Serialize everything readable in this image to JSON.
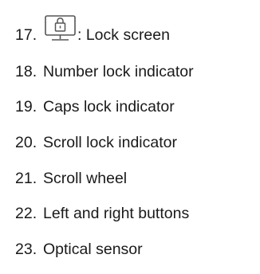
{
  "items": [
    {
      "number": "17.",
      "label": ": Lock screen",
      "icon": "monitor-lock-icon"
    },
    {
      "number": "18.",
      "label": "Number lock indicator"
    },
    {
      "number": "19.",
      "label": "Caps lock indicator"
    },
    {
      "number": "20.",
      "label": "Scroll lock indicator"
    },
    {
      "number": "21.",
      "label": "Scroll wheel"
    },
    {
      "number": "22.",
      "label": "Left and right buttons"
    },
    {
      "number": "23.",
      "label": "Optical sensor"
    }
  ],
  "colors": {
    "text": "#1a1a1a",
    "icon_stroke": "#555555"
  }
}
